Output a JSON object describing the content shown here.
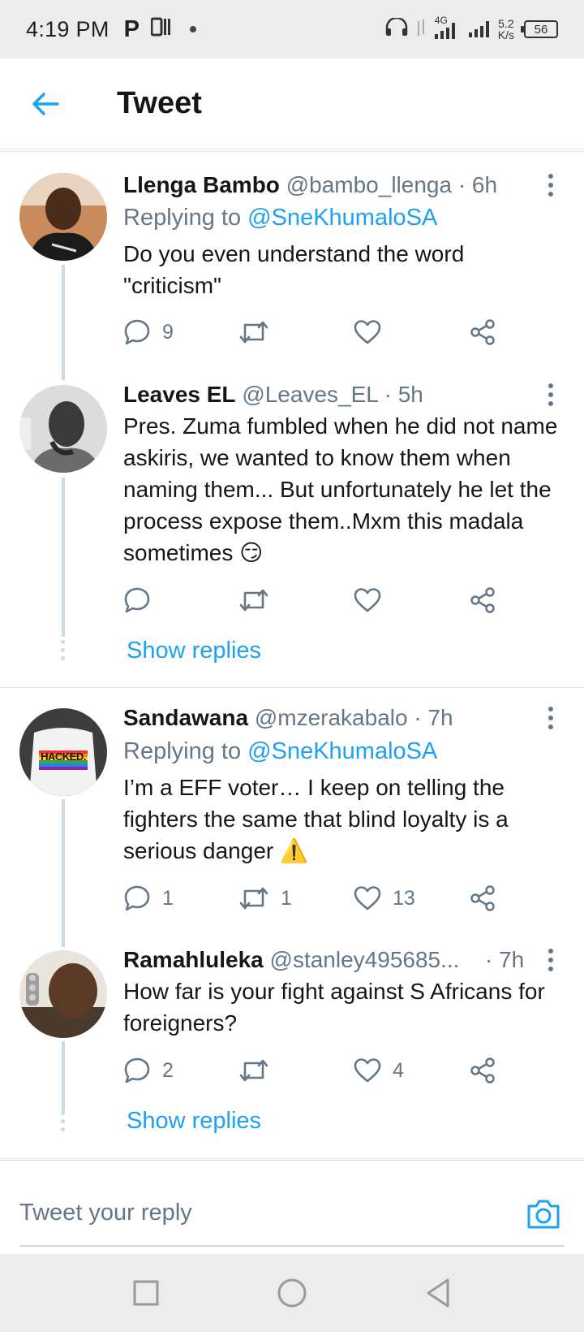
{
  "status_bar": {
    "time": "4:19 PM",
    "p_glyph": "P",
    "network_type": "4G",
    "net_speed_value": "5.2",
    "net_speed_unit": "K/s",
    "battery": "56"
  },
  "header": {
    "title": "Tweet",
    "back_icon": "arrow-left-icon"
  },
  "tweets": [
    {
      "name": "Llenga Bambo",
      "handle": "@bambo_llenga · 6h",
      "replying_prefix": "Replying to ",
      "replying_to": "@SneKhumaloSA",
      "text": "Do you even understand the word \"criticism\"",
      "counts": {
        "reply": "9",
        "retweet": "",
        "like": ""
      }
    },
    {
      "name": "Leaves EL",
      "handle": "@Leaves_EL · 5h",
      "text": "Pres. Zuma fumbled when he did not name askiris, we wanted to know them when naming them... But unfortunately he let the process expose them..Mxm this madala sometimes 😏",
      "counts": {
        "reply": "",
        "retweet": "",
        "like": ""
      },
      "show_replies": "Show replies"
    },
    {
      "name": "Sandawana",
      "handle": "@mzerakabalo · 7h",
      "replying_prefix": "Replying to ",
      "replying_to": "@SneKhumaloSA",
      "text": "I’m a EFF voter… I keep on telling the fighters the same that blind loyalty is a serious danger ⚠️",
      "counts": {
        "reply": "1",
        "retweet": "1",
        "like": "13"
      }
    },
    {
      "name": "Ramahluleka",
      "handle": "@stanley495685...",
      "time": "· 7h",
      "text": "How far is your fight against S Africans for foreigners?",
      "counts": {
        "reply": "2",
        "retweet": "",
        "like": "4"
      },
      "show_replies": "Show replies"
    }
  ],
  "avatar_3_badge": "HACKED.",
  "reply_bar": {
    "placeholder": "Tweet your reply",
    "camera_icon": "camera-icon"
  },
  "colors": {
    "accent": "#1da1f2",
    "secondary_text": "#657786",
    "primary_text": "#14171a",
    "divider": "#e1e8ed"
  }
}
